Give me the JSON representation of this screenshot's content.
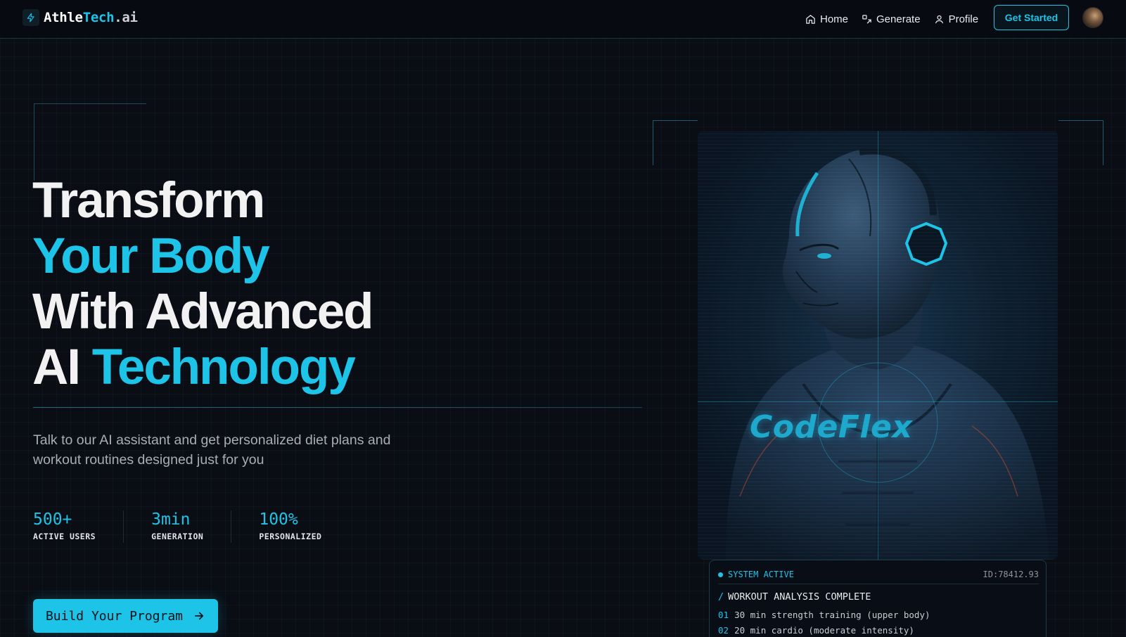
{
  "brand": {
    "part1": "Athle",
    "part2": "Tech",
    "part3": ".ai"
  },
  "nav": {
    "links": [
      {
        "label": "Home",
        "icon": "home-icon"
      },
      {
        "label": "Generate",
        "icon": "generate-icon"
      },
      {
        "label": "Profile",
        "icon": "user-icon"
      }
    ],
    "cta_label": "Get Started"
  },
  "hero": {
    "line1": "Transform",
    "line2": "Your Body",
    "line3": "With Advanced",
    "line4_a": "AI ",
    "line4_b": "Technology",
    "subtitle": "Talk to our AI assistant and get personalized diet plans and workout routines designed just for you",
    "stats": [
      {
        "value": "500+",
        "label": "ACTIVE USERS"
      },
      {
        "value": "3min",
        "label": "GENERATION"
      },
      {
        "value": "100%",
        "label": "PERSONALIZED"
      }
    ],
    "build_label": "Build Your Program"
  },
  "card": {
    "brand_text": "CodeFlex"
  },
  "terminal": {
    "status": "SYSTEM ACTIVE",
    "id": "ID:78412.93",
    "title": "WORKOUT ANALYSIS COMPLETE",
    "items": [
      {
        "num": "01",
        "text": "30 min strength training (upper body)"
      },
      {
        "num": "02",
        "text": "20 min cardio (moderate intensity)"
      }
    ]
  },
  "colors": {
    "accent": "#1ec4e8",
    "background": "#0a0d14",
    "text": "#f2f2f2",
    "muted": "#a9adb6"
  }
}
